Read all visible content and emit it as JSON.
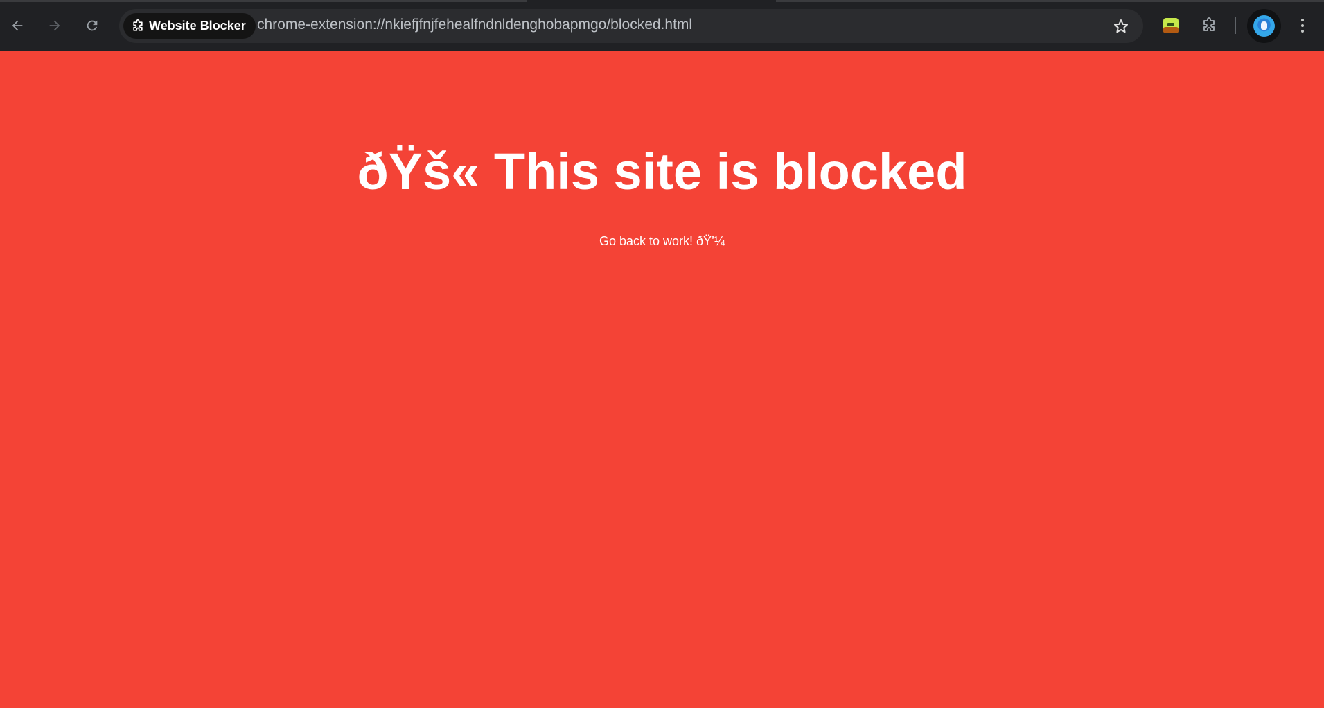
{
  "browser": {
    "site_chip_label": "Website Blocker",
    "url": "chrome-extension://nkiefjfnjfehealfndnldenghobapmgo/blocked.html",
    "icons": {
      "back": "back-arrow-icon",
      "forward": "forward-arrow-icon",
      "reload": "reload-icon",
      "extension_chip": "puzzle-piece-icon",
      "bookmark": "star-icon",
      "extension_app": "green-extension-icon",
      "extensions_menu": "puzzle-piece-icon",
      "profile": "avatar",
      "menu": "three-dot-menu-icon"
    },
    "colors": {
      "toolbar_bg": "#202124",
      "omnibox_bg": "#2b2c2f",
      "chip_bg": "#141414",
      "url_text": "#bdc1c6"
    }
  },
  "page": {
    "background_color": "#f44336",
    "headline": "ðŸš« This site is blocked",
    "subtext": "Go back to work! ðŸ’¼"
  }
}
